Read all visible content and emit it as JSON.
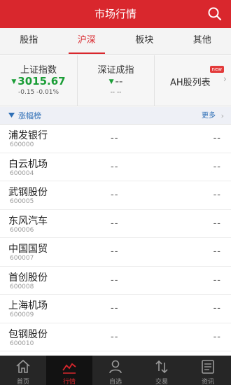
{
  "header": {
    "title": "市场行情"
  },
  "tabs": [
    {
      "label": "股指"
    },
    {
      "label": "沪深"
    },
    {
      "label": "板块"
    },
    {
      "label": "其他"
    }
  ],
  "active_tab": "沪深",
  "indices": [
    {
      "name": "上证指数",
      "value": "3015.67",
      "change": "-0.15",
      "change_pct": "-0.01%"
    },
    {
      "name": "深证成指",
      "value": "--",
      "change": "--",
      "change_pct": "--"
    },
    {
      "name": "AH股列表",
      "badge": "new"
    }
  ],
  "section": {
    "title": "涨幅榜",
    "more": "更多"
  },
  "stocks": [
    {
      "name": "浦发银行",
      "code": "600000",
      "price": "--",
      "change": "--"
    },
    {
      "name": "白云机场",
      "code": "600004",
      "price": "--",
      "change": "--"
    },
    {
      "name": "武钢股份",
      "code": "600005",
      "price": "--",
      "change": "--"
    },
    {
      "name": "东风汽车",
      "code": "600006",
      "price": "--",
      "change": "--"
    },
    {
      "name": "中国国贸",
      "code": "600007",
      "price": "--",
      "change": "--"
    },
    {
      "name": "首创股份",
      "code": "600008",
      "price": "--",
      "change": "--"
    },
    {
      "name": "上海机场",
      "code": "600009",
      "price": "--",
      "change": "--"
    },
    {
      "name": "包钢股份",
      "code": "600010",
      "price": "--",
      "change": "--"
    }
  ],
  "nav": [
    {
      "label": "首页",
      "icon": "home-icon"
    },
    {
      "label": "行情",
      "icon": "chart-icon"
    },
    {
      "label": "自选",
      "icon": "user-icon"
    },
    {
      "label": "交易",
      "icon": "trade-icon"
    },
    {
      "label": "资讯",
      "icon": "news-icon"
    }
  ],
  "colors": {
    "brand": "#d9272d",
    "down": "#1a9d36",
    "link": "#2f6fb6"
  }
}
